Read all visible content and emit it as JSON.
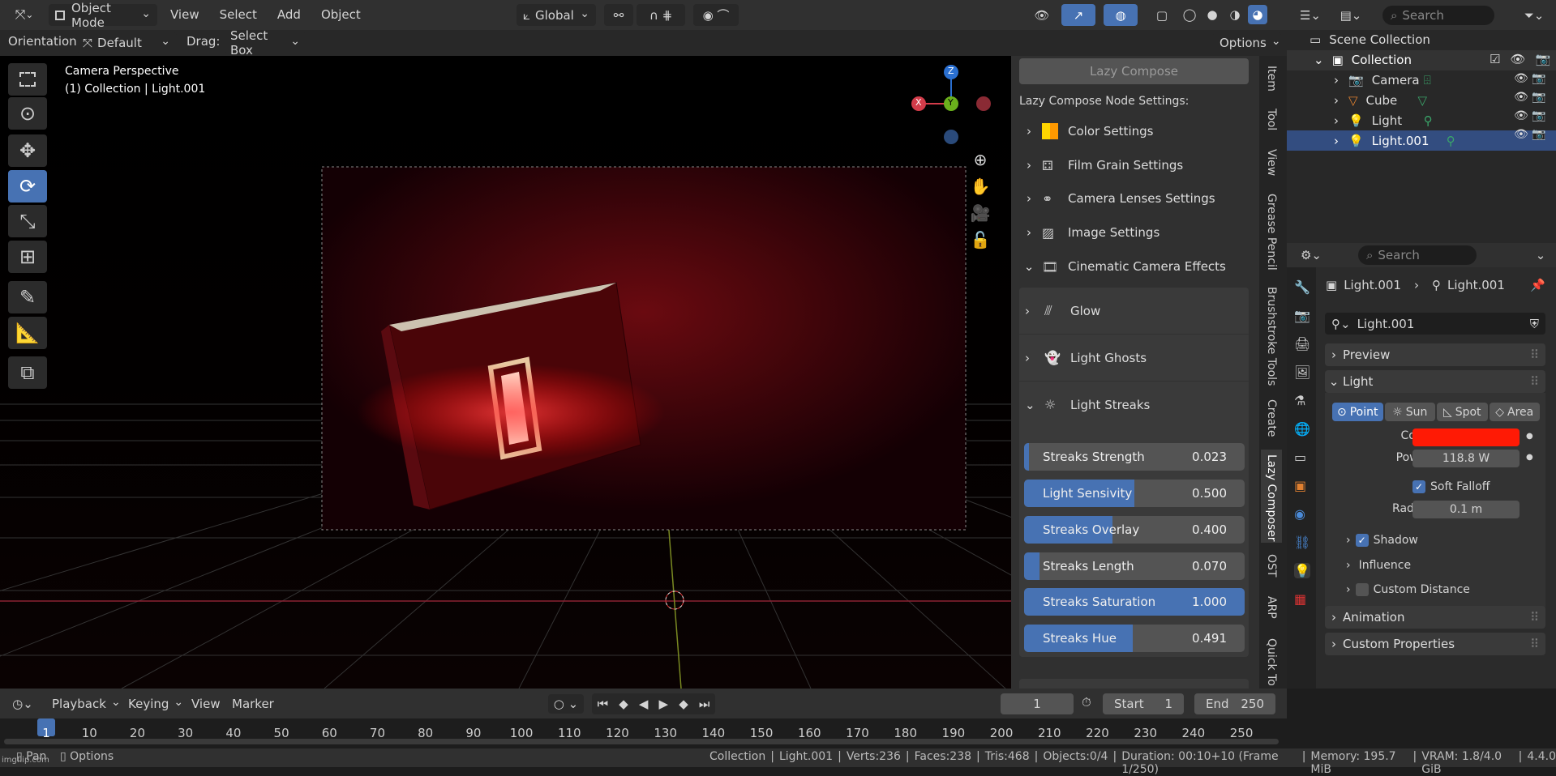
{
  "topbar": {
    "mode": "Object Mode",
    "menus": [
      "View",
      "Select",
      "Add",
      "Object"
    ],
    "transform_orientation": "Global"
  },
  "toolheader": {
    "orientation_label": "Orientation:",
    "orientation_value": "Default",
    "drag_label": "Drag:",
    "drag_value": "Select Box",
    "options": "Options"
  },
  "viewport": {
    "title": "Camera Perspective",
    "subtitle": "(1) Collection | Light.001",
    "gizmo_axes": {
      "z": "Z",
      "y": "Y",
      "x": "X"
    }
  },
  "lazy_compose": {
    "button": "Lazy Compose",
    "header": "Lazy Compose Node Settings:",
    "sections": [
      {
        "label": "Color Settings"
      },
      {
        "label": "Film Grain Settings"
      },
      {
        "label": "Camera Lenses Settings"
      },
      {
        "label": "Image Settings"
      },
      {
        "label": "Cinematic Camera Effects"
      }
    ],
    "subsections": [
      "Glow",
      "Light Ghosts",
      "Light Streaks"
    ],
    "sliders": [
      {
        "label": "Streaks Strength",
        "value": "0.023",
        "fraction": 0.023
      },
      {
        "label": "Light Sensivity",
        "value": "0.500",
        "fraction": 0.5
      },
      {
        "label": "Streaks Overlay",
        "value": "0.400",
        "fraction": 0.4
      },
      {
        "label": "Streaks Length",
        "value": "0.070",
        "fraction": 0.07
      },
      {
        "label": "Streaks Saturation",
        "value": "1.000",
        "fraction": 1.0
      },
      {
        "label": "Streaks Hue",
        "value": "0.491",
        "fraction": 0.491
      }
    ]
  },
  "side_tabs": [
    "Item",
    "Tool",
    "View",
    "Grease Pencil",
    "Brushstroke Tools",
    "Create",
    "Lazy Composer",
    "OST",
    "ARP",
    "Quick To"
  ],
  "outliner": {
    "search_placeholder": "Search",
    "scene_collection": "Scene Collection",
    "collection": "Collection",
    "items": [
      "Camera",
      "Cube",
      "Light",
      "Light.001"
    ]
  },
  "properties": {
    "search_placeholder": "Search",
    "breadcrumb_object": "Light.001",
    "breadcrumb_data": "Light.001",
    "datablock": "Light.001",
    "panels": {
      "preview": "Preview",
      "light": "Light",
      "animation": "Animation",
      "custom": "Custom Properties"
    },
    "light_types": [
      "Point",
      "Sun",
      "Spot",
      "Area"
    ],
    "color_label": "Color",
    "color_value": "#ff1a05",
    "power_label": "Power",
    "power_value": "118.8 W",
    "soft_falloff": "Soft Falloff",
    "radius_label": "Radius",
    "radius_value": "0.1 m",
    "shadow": "Shadow",
    "influence": "Influence",
    "custom_distance": "Custom Distance"
  },
  "timeline": {
    "menus": [
      "Playback",
      "Keying",
      "View",
      "Marker"
    ],
    "current_frame": "1",
    "start_label": "Start",
    "start_value": "1",
    "end_label": "End",
    "end_value": "250",
    "ticks": [
      "1",
      "10",
      "20",
      "30",
      "40",
      "50",
      "60",
      "70",
      "80",
      "90",
      "100",
      "110",
      "120",
      "130",
      "140",
      "150",
      "160",
      "170",
      "180",
      "190",
      "200",
      "210",
      "220",
      "230",
      "240",
      "250"
    ]
  },
  "statusbar": {
    "pan": "Pan",
    "options": "Options",
    "stats": [
      "Collection",
      "Light.001",
      "Verts:236",
      "Faces:238",
      "Tris:468",
      "Objects:0/4",
      "Duration: 00:10+10 (Frame 1/250)",
      "Memory: 195.7 MiB",
      "VRAM: 1.8/4.0 GiB",
      "4.4.0"
    ],
    "watermark": "imgflip.com"
  }
}
